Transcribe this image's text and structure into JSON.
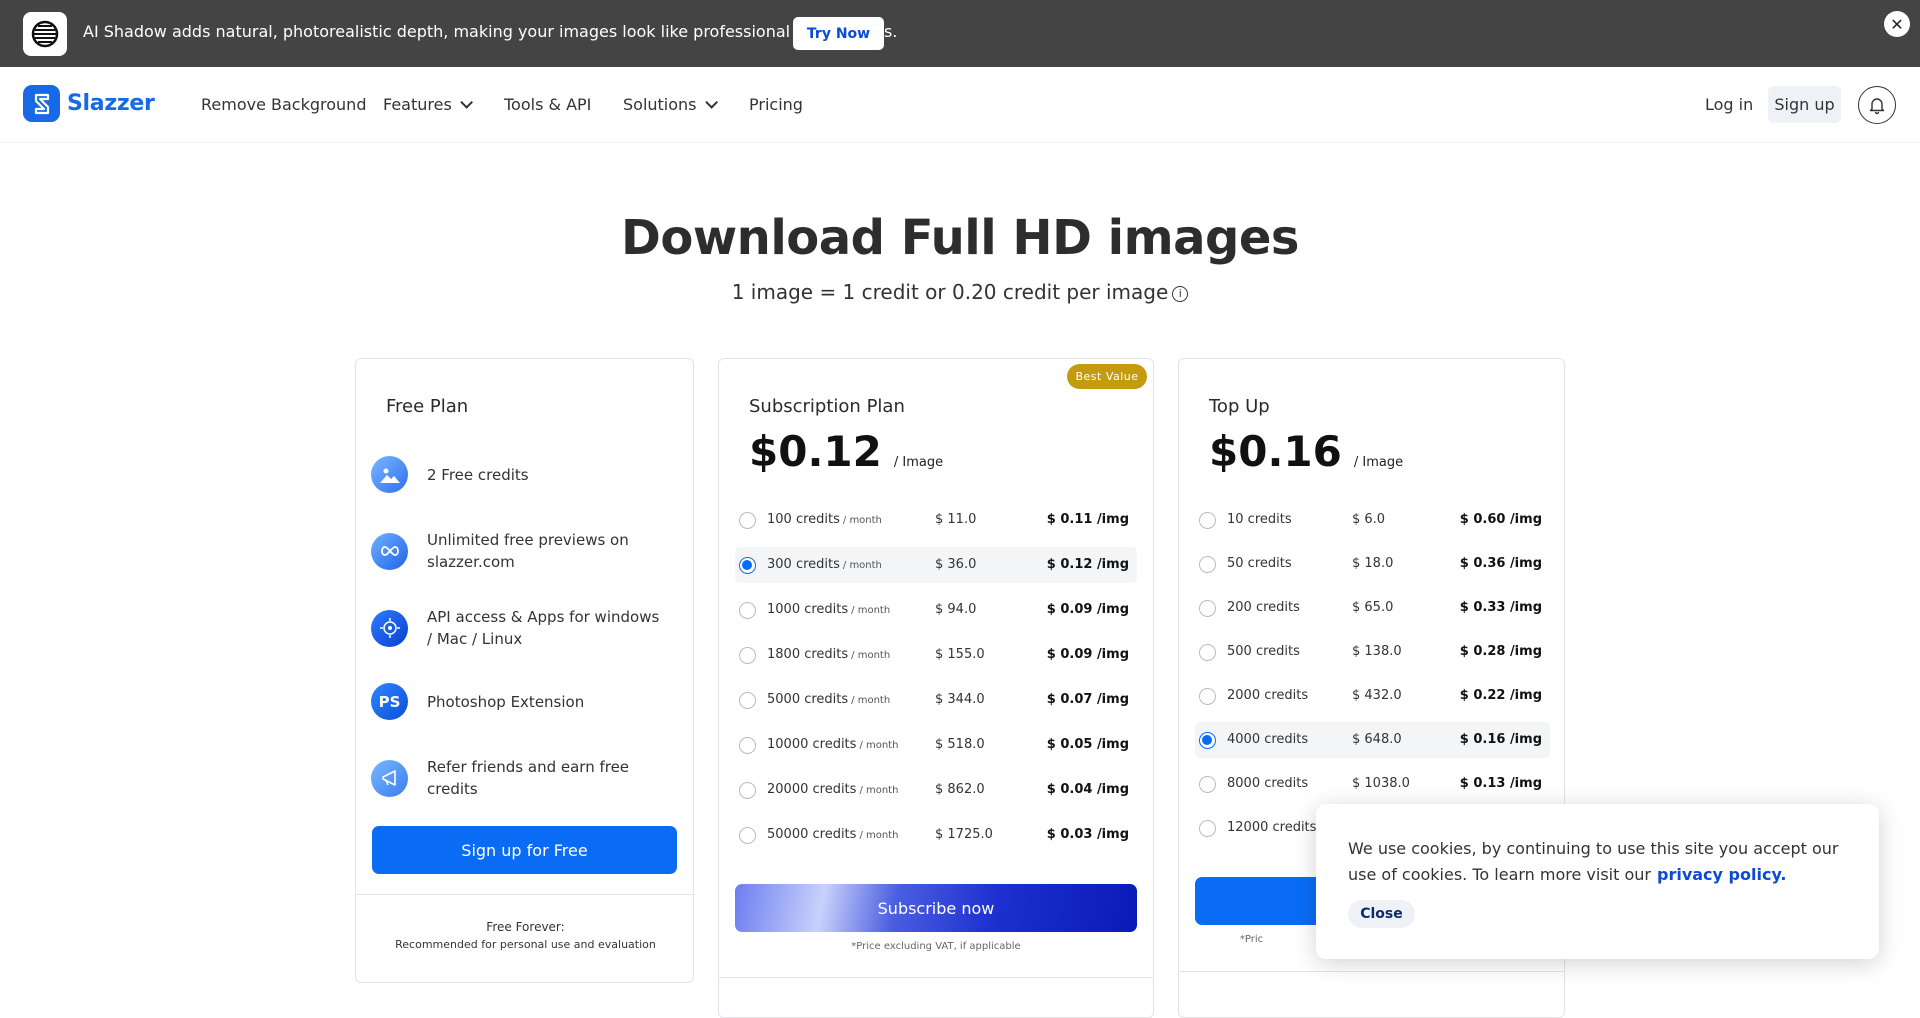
{
  "banner": {
    "message": "AI Shadow adds natural, photorealistic depth, making your images look like professional studio shots.",
    "cta": "Try Now",
    "close": "✕"
  },
  "nav": {
    "brand": "Slazzer",
    "items": [
      "Remove Background",
      "Features",
      "Tools & API",
      "Solutions",
      "Pricing"
    ],
    "login": "Log in",
    "signup": "Sign up"
  },
  "hero": {
    "title": "Download Full HD images",
    "subtitle": "1 image = 1 credit or 0.20 credit per image",
    "info_icon": "i"
  },
  "free_plan": {
    "title": "Free Plan",
    "features": [
      {
        "icon": "image-icon",
        "text": "2 Free credits"
      },
      {
        "icon": "infinity-icon",
        "text": "Unlimited free previews on slazzer.com"
      },
      {
        "icon": "api-icon",
        "text": "API access & Apps for windows / Mac / Linux"
      },
      {
        "icon": "photoshop-icon",
        "text": "Photoshop Extension",
        "glyph": "PS"
      },
      {
        "icon": "megaphone-icon",
        "text": "Refer friends and earn free credits"
      }
    ],
    "cta": "Sign up for Free",
    "footer_title": "Free Forever:",
    "footer_text": "Recommended for personal use and evaluation"
  },
  "subscription_plan": {
    "badge": "Best Value",
    "title": "Subscription Plan",
    "price": "$0.12",
    "per": "/ Image",
    "unit": "/ month",
    "rows": [
      {
        "credits": "100 credits",
        "price": "$ 11.0",
        "per_img": "$ 0.11 /img",
        "selected": false
      },
      {
        "credits": "300 credits",
        "price": "$ 36.0",
        "per_img": "$ 0.12 /img",
        "selected": true
      },
      {
        "credits": "1000 credits",
        "price": "$ 94.0",
        "per_img": "$ 0.09 /img",
        "selected": false
      },
      {
        "credits": "1800 credits",
        "price": "$ 155.0",
        "per_img": "$ 0.09 /img",
        "selected": false
      },
      {
        "credits": "5000 credits",
        "price": "$ 344.0",
        "per_img": "$ 0.07 /img",
        "selected": false
      },
      {
        "credits": "10000 credits",
        "price": "$ 518.0",
        "per_img": "$ 0.05 /img",
        "selected": false
      },
      {
        "credits": "20000 credits",
        "price": "$ 862.0",
        "per_img": "$ 0.04 /img",
        "selected": false
      },
      {
        "credits": "50000 credits",
        "price": "$ 1725.0",
        "per_img": "$ 0.03 /img",
        "selected": false
      }
    ],
    "cta": "Subscribe now",
    "vat": "*Price excluding VAT, if applicable"
  },
  "topup_plan": {
    "title": "Top Up",
    "price": "$0.16",
    "per": "/ Image",
    "rows": [
      {
        "credits": "10 credits",
        "price": "$ 6.0",
        "per_img": "$ 0.60 /img",
        "selected": false
      },
      {
        "credits": "50 credits",
        "price": "$ 18.0",
        "per_img": "$ 0.36 /img",
        "selected": false
      },
      {
        "credits": "200 credits",
        "price": "$ 65.0",
        "per_img": "$ 0.33 /img",
        "selected": false
      },
      {
        "credits": "500 credits",
        "price": "$ 138.0",
        "per_img": "$ 0.28 /img",
        "selected": false
      },
      {
        "credits": "2000 credits",
        "price": "$ 432.0",
        "per_img": "$ 0.22 /img",
        "selected": false
      },
      {
        "credits": "4000 credits",
        "price": "$ 648.0",
        "per_img": "$ 0.16 /img",
        "selected": true
      },
      {
        "credits": "8000 credits",
        "price": "$ 1038.0",
        "per_img": "$ 0.13 /img",
        "selected": false
      },
      {
        "credits": "12000 credits",
        "price": "",
        "per_img": "",
        "selected": false
      }
    ],
    "vat": "*Pric"
  },
  "cookie": {
    "text": "We use cookies, by continuing to use this site you accept our use of cookies.  To learn more visit our",
    "link": "privacy policy.",
    "close": "Close"
  },
  "colors": {
    "brand": "#1769e6",
    "primary_button": "#0a6cf5",
    "badge": "#c49a0f",
    "banner_bg": "#444444"
  }
}
